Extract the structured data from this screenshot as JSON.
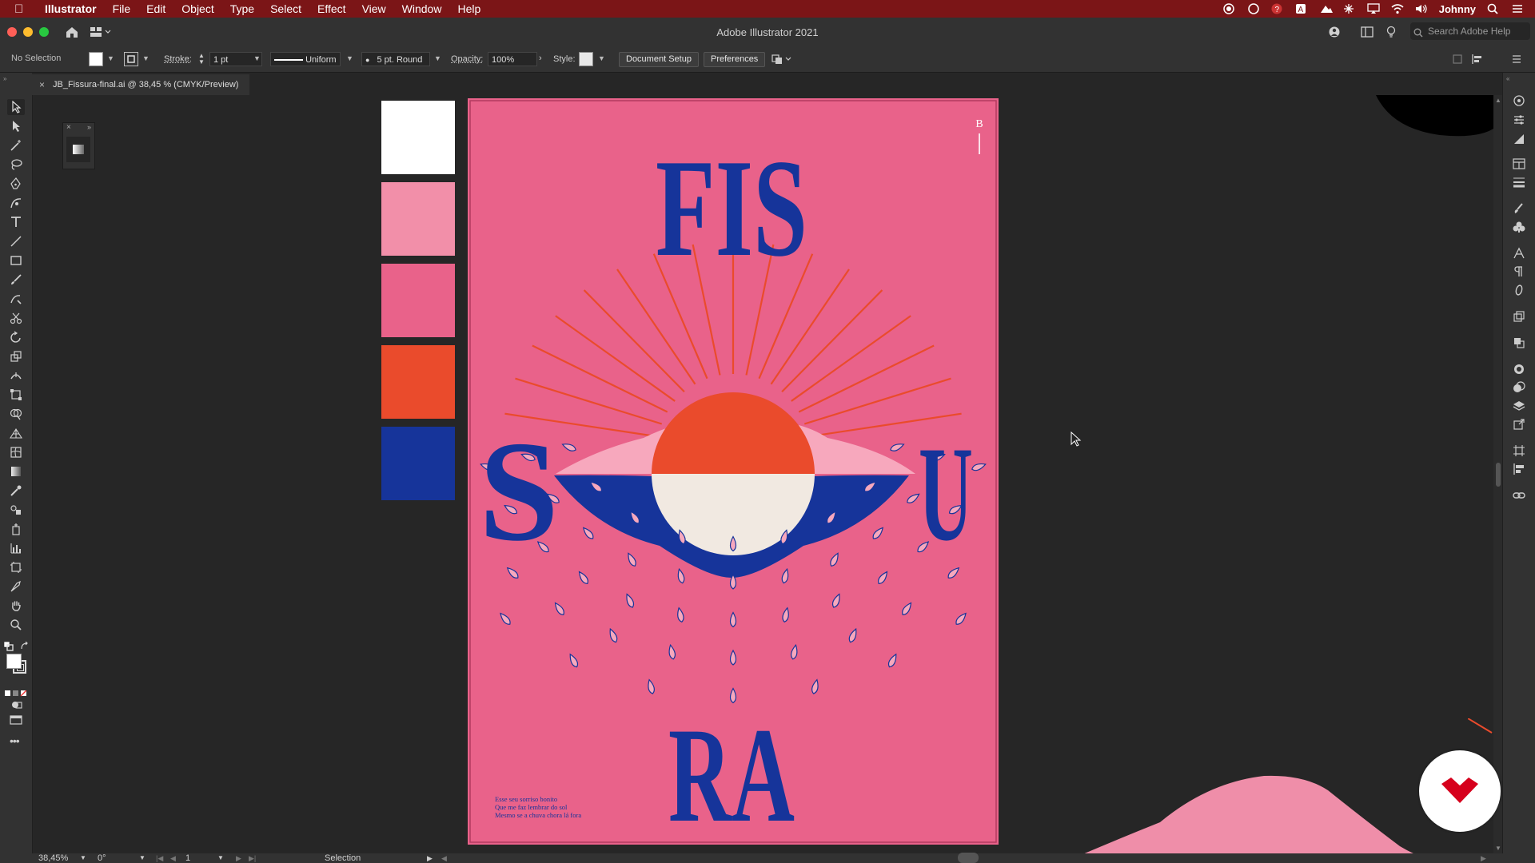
{
  "menubar": {
    "app_name": "Illustrator",
    "menus": [
      "File",
      "Edit",
      "Object",
      "Type",
      "Select",
      "Effect",
      "View",
      "Window",
      "Help"
    ],
    "user_name": "Johnny",
    "color": "#7b1517"
  },
  "window": {
    "title": "Adobe Illustrator 2021",
    "search_placeholder": "Search Adobe Help"
  },
  "control_bar": {
    "selection_label": "No Selection",
    "stroke_label": "Stroke:",
    "stroke_weight": "1 pt",
    "profile_label": "Uniform",
    "brush_label": "5 pt. Round",
    "opacity_label": "Opacity:",
    "opacity_value": "100%",
    "style_label": "Style:",
    "document_setup_label": "Document Setup",
    "preferences_label": "Preferences"
  },
  "document_tab": {
    "label": "JB_Fissura-final.ai @ 38,45 % (CMYK/Preview)"
  },
  "palette_swatches": [
    "#ffffff",
    "#f28fa9",
    "#e9628a",
    "#ea4b2c",
    "#16349a"
  ],
  "poster": {
    "background": "#e9628a",
    "title_top": "FIS",
    "letter_left": "S",
    "letter_right": "U",
    "title_bottom": "RA",
    "corner_mark": "B",
    "caption_lines": [
      "Esse seu sorriso bonito",
      "Que me faz lembrar do sol",
      "Mesmo se a chuva chora lá fora"
    ],
    "colors": {
      "blue": "#16349a",
      "red": "#ea4b2c",
      "pale": "#f1e9e1",
      "light_pink": "#f7a8bd"
    }
  },
  "status_bar": {
    "zoom": "38,45%",
    "rotation": "0°",
    "artboard_number": "1",
    "tool_name": "Selection"
  }
}
